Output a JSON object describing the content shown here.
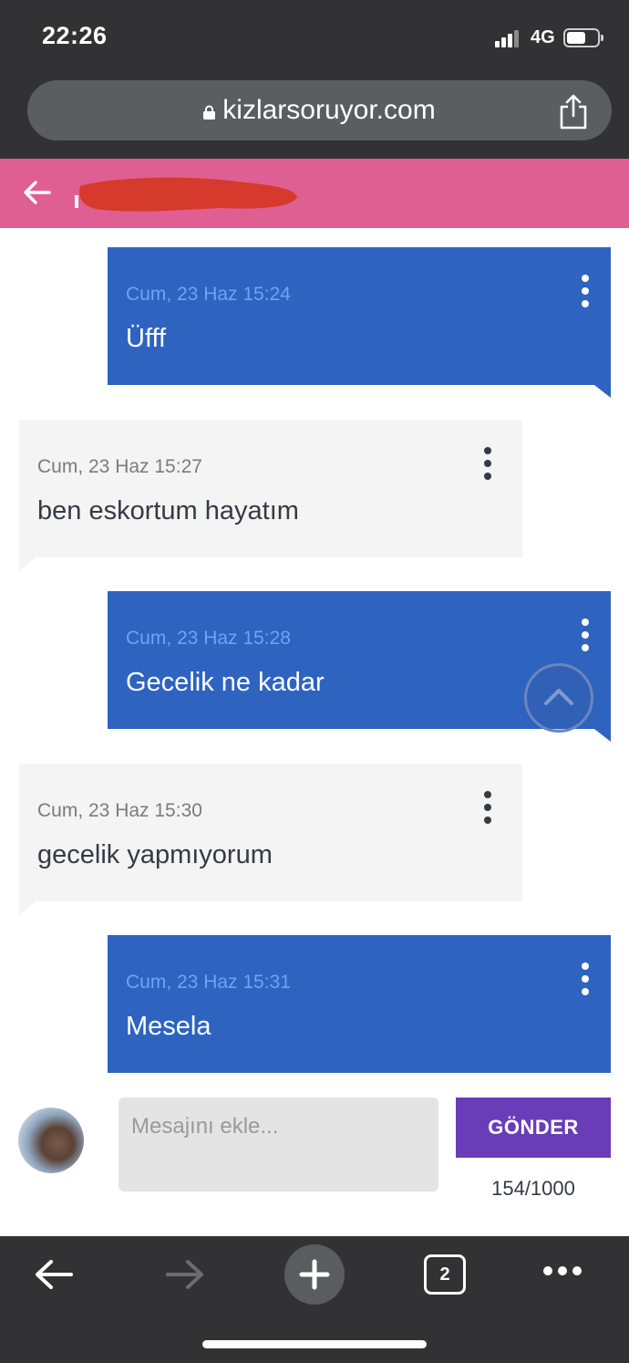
{
  "status_bar": {
    "time": "22:26",
    "network": "4G",
    "icons": [
      "signal-icon",
      "battery-icon"
    ]
  },
  "browser": {
    "url": "kizlarsoruyor.com",
    "icons": [
      "lock-icon",
      "share-icon"
    ],
    "open_tab_count": "2"
  },
  "chat_header": {
    "icons": [
      "back-arrow-icon"
    ],
    "contact_name_redacted": true,
    "colors": {
      "header_bg": "#e05f92"
    }
  },
  "messages": [
    {
      "direction": "sent",
      "timestamp": "Cum, 23 Haz 15:24",
      "text": "Üfff"
    },
    {
      "direction": "received",
      "timestamp": "Cum, 23 Haz 15:27",
      "text": "ben eskortum hayatım"
    },
    {
      "direction": "sent",
      "timestamp": "Cum, 23 Haz 15:28",
      "text": "Gecelik ne kadar"
    },
    {
      "direction": "received",
      "timestamp": "Cum, 23 Haz 15:30",
      "text": "gecelik yapmıyorum"
    },
    {
      "direction": "sent",
      "timestamp": "Cum, 23 Haz 15:31",
      "text": "Mesela"
    }
  ],
  "composer": {
    "placeholder": "Mesajını ekle...",
    "value": "",
    "send_label": "GÖNDER",
    "char_counter": "154/1000",
    "colors": {
      "send_bg": "#6a3db8",
      "sent_bubble": "#2e63c0",
      "received_bubble": "#f4f4f4"
    }
  },
  "toolbar": {
    "icons": [
      "back-arrow-icon",
      "forward-arrow-icon",
      "plus-icon",
      "tabs-icon",
      "more-dots-icon"
    ]
  }
}
